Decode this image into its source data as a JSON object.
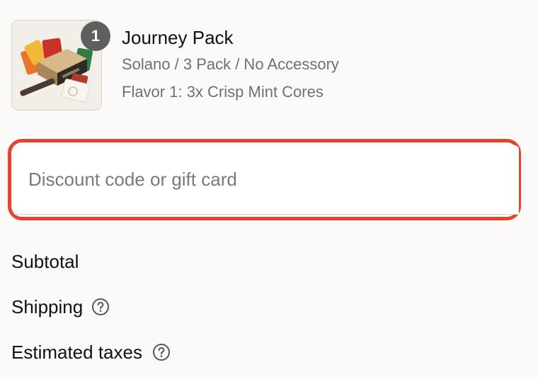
{
  "product": {
    "quantity": "1",
    "title": "Journey Pack",
    "variant": "Solano / 3 Pack / No Accessory",
    "flavor": "Flavor 1: 3x Crisp Mint Cores",
    "image_icon": "product-photo-box-kit"
  },
  "discount": {
    "placeholder": "Discount code or gift card",
    "value": "",
    "highlight_color": "#e5432b"
  },
  "summary": {
    "subtotal_label": "Subtotal",
    "shipping_label": "Shipping",
    "taxes_label": "Estimated taxes",
    "help_icon": "question-circle-icon"
  }
}
